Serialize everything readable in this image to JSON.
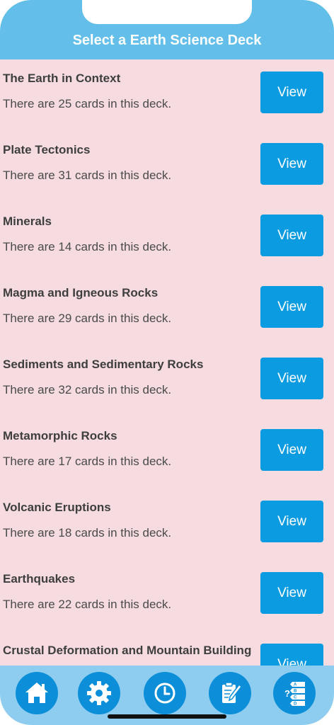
{
  "header": {
    "title": "Select a Earth Science Deck"
  },
  "decks": [
    {
      "title": "The Earth in Context",
      "subtitle": "There are 25 cards in this deck.",
      "button": "View"
    },
    {
      "title": "Plate Tectonics",
      "subtitle": "There are 31 cards in this deck.",
      "button": "View"
    },
    {
      "title": "Minerals",
      "subtitle": "There are 14 cards in this deck.",
      "button": "View"
    },
    {
      "title": "Magma and Igneous Rocks",
      "subtitle": "There are 29 cards in this deck.",
      "button": "View"
    },
    {
      "title": "Sediments and Sedimentary Rocks",
      "subtitle": "There are 32 cards in this deck.",
      "button": "View"
    },
    {
      "title": "Metamorphic Rocks",
      "subtitle": "There are 17 cards in this deck.",
      "button": "View"
    },
    {
      "title": "Volcanic Eruptions",
      "subtitle": "There are 18 cards in this deck.",
      "button": "View"
    },
    {
      "title": "Earthquakes",
      "subtitle": "There are 22 cards in this deck.",
      "button": "View"
    },
    {
      "title": "Crustal Deformation and Mountain Building",
      "subtitle": "",
      "button": "View"
    }
  ],
  "tabbar": {
    "items": [
      {
        "icon": "home-icon"
      },
      {
        "icon": "gear-icon"
      },
      {
        "icon": "clock-icon"
      },
      {
        "icon": "notepad-pencil-icon"
      },
      {
        "icon": "quiz-list-icon",
        "letters": [
          "?",
          "A",
          "B",
          "C",
          "D"
        ]
      }
    ]
  },
  "colors": {
    "header": "#63bfea",
    "list_background": "#f6dce0",
    "button": "#0b9be0",
    "tabbar": "#8fcdf0",
    "tab_circle": "#0c8fd8"
  }
}
